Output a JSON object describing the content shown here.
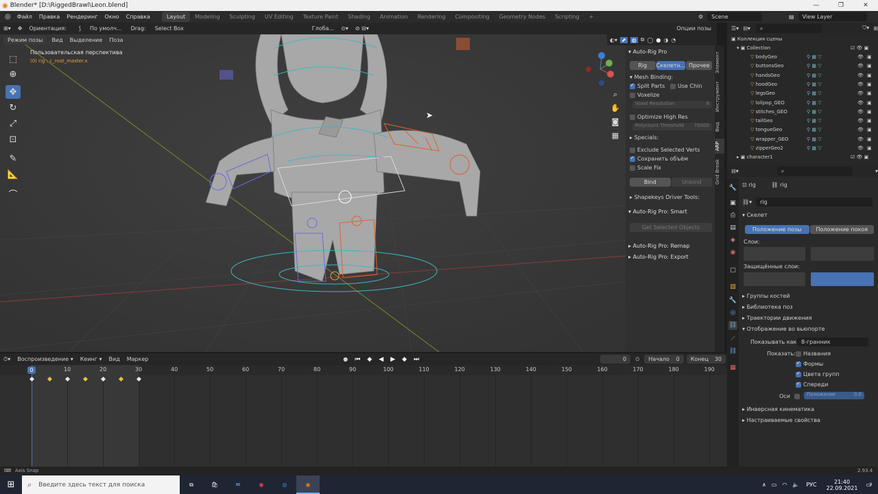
{
  "window": {
    "title": "Blender* [D:\\RiggedBrawl\\Leon.blend]",
    "min": "—",
    "max": "❐",
    "close": "✕"
  },
  "topbar": {
    "menus": [
      "Файл",
      "Правка",
      "Рендеринг",
      "Окно",
      "Справка"
    ],
    "workspaces": [
      "Layout",
      "Modeling",
      "Sculpting",
      "UV Editing",
      "Texture Paint",
      "Shading",
      "Animation",
      "Rendering",
      "Compositing",
      "Geometry Nodes",
      "Scripting"
    ],
    "add": "+",
    "scene": "Scene",
    "view_layer": "View Layer"
  },
  "viewport_header": {
    "orientation_label": "Ориентация:",
    "orientation_value": "По умолч...",
    "drag_label": "Drag:",
    "drag_value": "Select Box",
    "transform": "Глоба...",
    "mode": "Режим позы",
    "menus": [
      "Вид",
      "Выделение",
      "Поза"
    ],
    "options": "Опции позы"
  },
  "viewport": {
    "perspective": "Пользовательская перспектива",
    "object": "(0) rig : c_root_master.x",
    "axis_x": "X",
    "axis_y": "Y",
    "axis_z": "Z"
  },
  "npanel": {
    "title": "Auto-Rig Pro",
    "tabs": [
      "Rig",
      "Скелетн...",
      "Прочее"
    ],
    "mesh_binding": "Mesh Binding:",
    "split_parts": "Split Parts",
    "use_chin": "Use Chin",
    "voxelize": "Voxelize",
    "voxel_res": "Voxel Resolution",
    "voxel_res_val": "8",
    "optimize": "Optimize High Res",
    "poly_threshold": "Polycount Threshold",
    "poly_threshold_val": "70000",
    "specials": "Specials:",
    "exclude_verts": "Exclude Selected Verts",
    "preserve_volume": "Сохранить объём",
    "scale_fix": "Scale Fix",
    "bind": "Bind",
    "unbind": "Unbind",
    "shapekeys": "Shapekeys Driver Tools:",
    "smart": "Auto-Rig Pro: Smart",
    "get_selected": "Get Selected Objects",
    "remap": "Auto-Rig Pro: Remap",
    "export": "Auto-Rig Pro: Export",
    "side_tabs": [
      "Элемент",
      "Инструмент",
      "Вид",
      "ARP",
      "Grid Break"
    ]
  },
  "outliner": {
    "search_icon": "search-icon",
    "root": "Коллекция сцены",
    "collection": "Collection",
    "items": [
      "bodyGeo",
      "buttonsGeo",
      "handsGeo",
      "hoodGeo",
      "legsGeo",
      "lolipop_GEO",
      "stitches_GEO",
      "tailGeo",
      "tongueGeo",
      "wrapper_GEO",
      "zipperGeo2"
    ],
    "character": "character1"
  },
  "properties": {
    "object1": "rig",
    "object2": "rig",
    "data_name": "rig",
    "skeleton": "Скелет",
    "pose_position": "Положение позы",
    "rest_position": "Положение покоя",
    "layers": "Слои:",
    "protected_layers": "Защищённые слои:",
    "bone_groups": "Группы костей",
    "pose_library": "Библиотека поз",
    "motion_paths": "Траектории движения",
    "viewport_display": "Отображение во вьюпорте",
    "display_as_label": "Показывать как",
    "display_as_value": "8-гранник",
    "show_label": "Показать:",
    "names": "Названия",
    "shapes": "Формы",
    "group_colors": "Цвета групп",
    "in_front": "Спереди",
    "axes": "Оси",
    "position": "Положение",
    "position_val": "0.0",
    "ik": "Инверсная кинематика",
    "custom_props": "Настраиваемые свойства"
  },
  "timeline": {
    "playback": "Воспроизведение",
    "keying": "Кеинг",
    "menus": [
      "Вид",
      "Маркер"
    ],
    "current": "0",
    "start_label": "Начало",
    "start": "0",
    "end_label": "Конец",
    "end": "30",
    "frames": [
      "0",
      "10",
      "20",
      "30",
      "40",
      "50",
      "60",
      "70",
      "80",
      "90",
      "100",
      "110",
      "120",
      "130",
      "140",
      "150",
      "160",
      "170",
      "180",
      "190"
    ],
    "keyframes": [
      0,
      5,
      10,
      15,
      20,
      25,
      30
    ]
  },
  "status": {
    "left": "Axis Snap",
    "version": "2.93.4"
  },
  "taskbar": {
    "search": "Введите здесь текст для поиска",
    "lang": "РУС",
    "time": "21:40",
    "date": "22.09.2021",
    "notif": "3"
  },
  "colors": {
    "accent": "#4772b3",
    "orange": "#e8a33c",
    "keyframe": "#e8c23c"
  }
}
